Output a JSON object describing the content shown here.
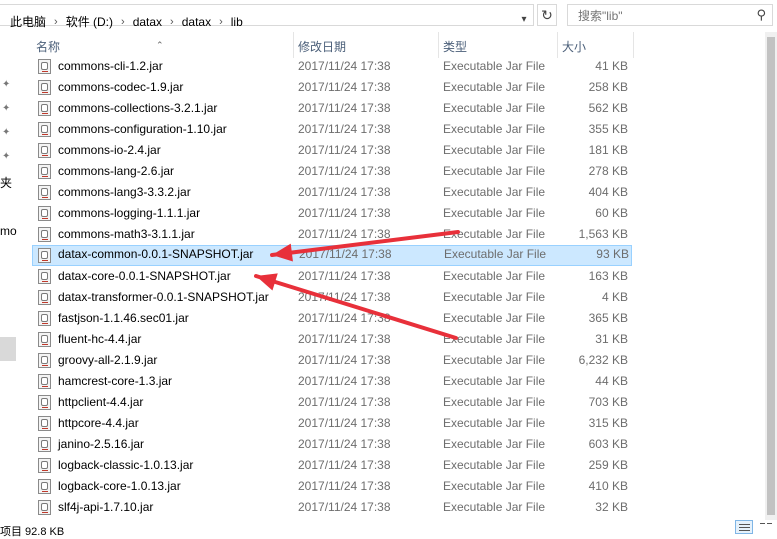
{
  "address": {
    "crumbs": [
      "此电脑",
      "软件 (D:)",
      "datax",
      "datax",
      "lib"
    ],
    "refresh_icon": "refresh-icon",
    "dropdown_icon": "chevron-down-icon"
  },
  "search": {
    "placeholder": "搜索\"lib\"",
    "icon": "search-icon"
  },
  "nav": {
    "fragment_1": "夹",
    "fragment_2": "mo"
  },
  "columns": {
    "name": "名称",
    "date": "修改日期",
    "type": "类型",
    "size": "大小"
  },
  "files": [
    {
      "name": "commons-cli-1.2.jar",
      "date": "2017/11/24 17:38",
      "type": "Executable Jar File",
      "size": "41 KB"
    },
    {
      "name": "commons-codec-1.9.jar",
      "date": "2017/11/24 17:38",
      "type": "Executable Jar File",
      "size": "258 KB"
    },
    {
      "name": "commons-collections-3.2.1.jar",
      "date": "2017/11/24 17:38",
      "type": "Executable Jar File",
      "size": "562 KB"
    },
    {
      "name": "commons-configuration-1.10.jar",
      "date": "2017/11/24 17:38",
      "type": "Executable Jar File",
      "size": "355 KB"
    },
    {
      "name": "commons-io-2.4.jar",
      "date": "2017/11/24 17:38",
      "type": "Executable Jar File",
      "size": "181 KB"
    },
    {
      "name": "commons-lang-2.6.jar",
      "date": "2017/11/24 17:38",
      "type": "Executable Jar File",
      "size": "278 KB"
    },
    {
      "name": "commons-lang3-3.3.2.jar",
      "date": "2017/11/24 17:38",
      "type": "Executable Jar File",
      "size": "404 KB"
    },
    {
      "name": "commons-logging-1.1.1.jar",
      "date": "2017/11/24 17:38",
      "type": "Executable Jar File",
      "size": "60 KB"
    },
    {
      "name": "commons-math3-3.1.1.jar",
      "date": "2017/11/24 17:38",
      "type": "Executable Jar File",
      "size": "1,563 KB"
    },
    {
      "name": "datax-common-0.0.1-SNAPSHOT.jar",
      "date": "2017/11/24 17:38",
      "type": "Executable Jar File",
      "size": "93 KB",
      "selected": true
    },
    {
      "name": "datax-core-0.0.1-SNAPSHOT.jar",
      "date": "2017/11/24 17:38",
      "type": "Executable Jar File",
      "size": "163 KB"
    },
    {
      "name": "datax-transformer-0.0.1-SNAPSHOT.jar",
      "date": "2017/11/24 17:38",
      "type": "Executable Jar File",
      "size": "4 KB"
    },
    {
      "name": "fastjson-1.1.46.sec01.jar",
      "date": "2017/11/24 17:38",
      "type": "Executable Jar File",
      "size": "365 KB"
    },
    {
      "name": "fluent-hc-4.4.jar",
      "date": "2017/11/24 17:38",
      "type": "Executable Jar File",
      "size": "31 KB"
    },
    {
      "name": "groovy-all-2.1.9.jar",
      "date": "2017/11/24 17:38",
      "type": "Executable Jar File",
      "size": "6,232 KB"
    },
    {
      "name": "hamcrest-core-1.3.jar",
      "date": "2017/11/24 17:38",
      "type": "Executable Jar File",
      "size": "44 KB"
    },
    {
      "name": "httpclient-4.4.jar",
      "date": "2017/11/24 17:38",
      "type": "Executable Jar File",
      "size": "703 KB"
    },
    {
      "name": "httpcore-4.4.jar",
      "date": "2017/11/24 17:38",
      "type": "Executable Jar File",
      "size": "315 KB"
    },
    {
      "name": "janino-2.5.16.jar",
      "date": "2017/11/24 17:38",
      "type": "Executable Jar File",
      "size": "603 KB"
    },
    {
      "name": "logback-classic-1.0.13.jar",
      "date": "2017/11/24 17:38",
      "type": "Executable Jar File",
      "size": "259 KB"
    },
    {
      "name": "logback-core-1.0.13.jar",
      "date": "2017/11/24 17:38",
      "type": "Executable Jar File",
      "size": "410 KB"
    },
    {
      "name": "slf4j-api-1.7.10.jar",
      "date": "2017/11/24 17:38",
      "type": "Executable Jar File",
      "size": "32 KB"
    }
  ],
  "annotation": {
    "arrow_color": "#e8303a"
  },
  "status": {
    "text": "项目  92.8 KB"
  },
  "colors": {
    "selected_bg": "#cce8ff",
    "selected_border": "#99d1ff",
    "header_text": "#4c607a"
  }
}
